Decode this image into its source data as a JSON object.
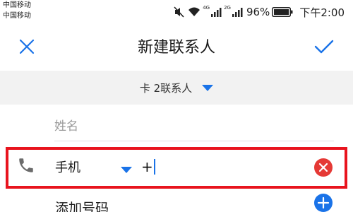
{
  "status_bar": {
    "carrier_1": "中国移动",
    "carrier_2": "中国移动",
    "signal_1_label": "4G",
    "signal_2_label": "2G",
    "battery_percent": "96%",
    "time": "下午2:00",
    "icons": [
      "mute-icon",
      "wifi-icon",
      "signal-icon",
      "signal-icon",
      "battery-icon"
    ]
  },
  "header": {
    "title": "新建联系人",
    "close_icon": "close-icon",
    "confirm_icon": "check-icon"
  },
  "account": {
    "label": "卡 2联系人",
    "icon": "caret-down-icon"
  },
  "name_field": {
    "placeholder": "姓名",
    "value": ""
  },
  "phone": {
    "icon": "phone-icon",
    "type_label": "手机",
    "value": "+",
    "clear_icon": "clear-icon"
  },
  "add_number": {
    "label": "添加号码",
    "icon": "add-icon"
  },
  "colors": {
    "accent": "#1a73e8",
    "highlight": "#e8141e",
    "clear": "#e53935"
  }
}
